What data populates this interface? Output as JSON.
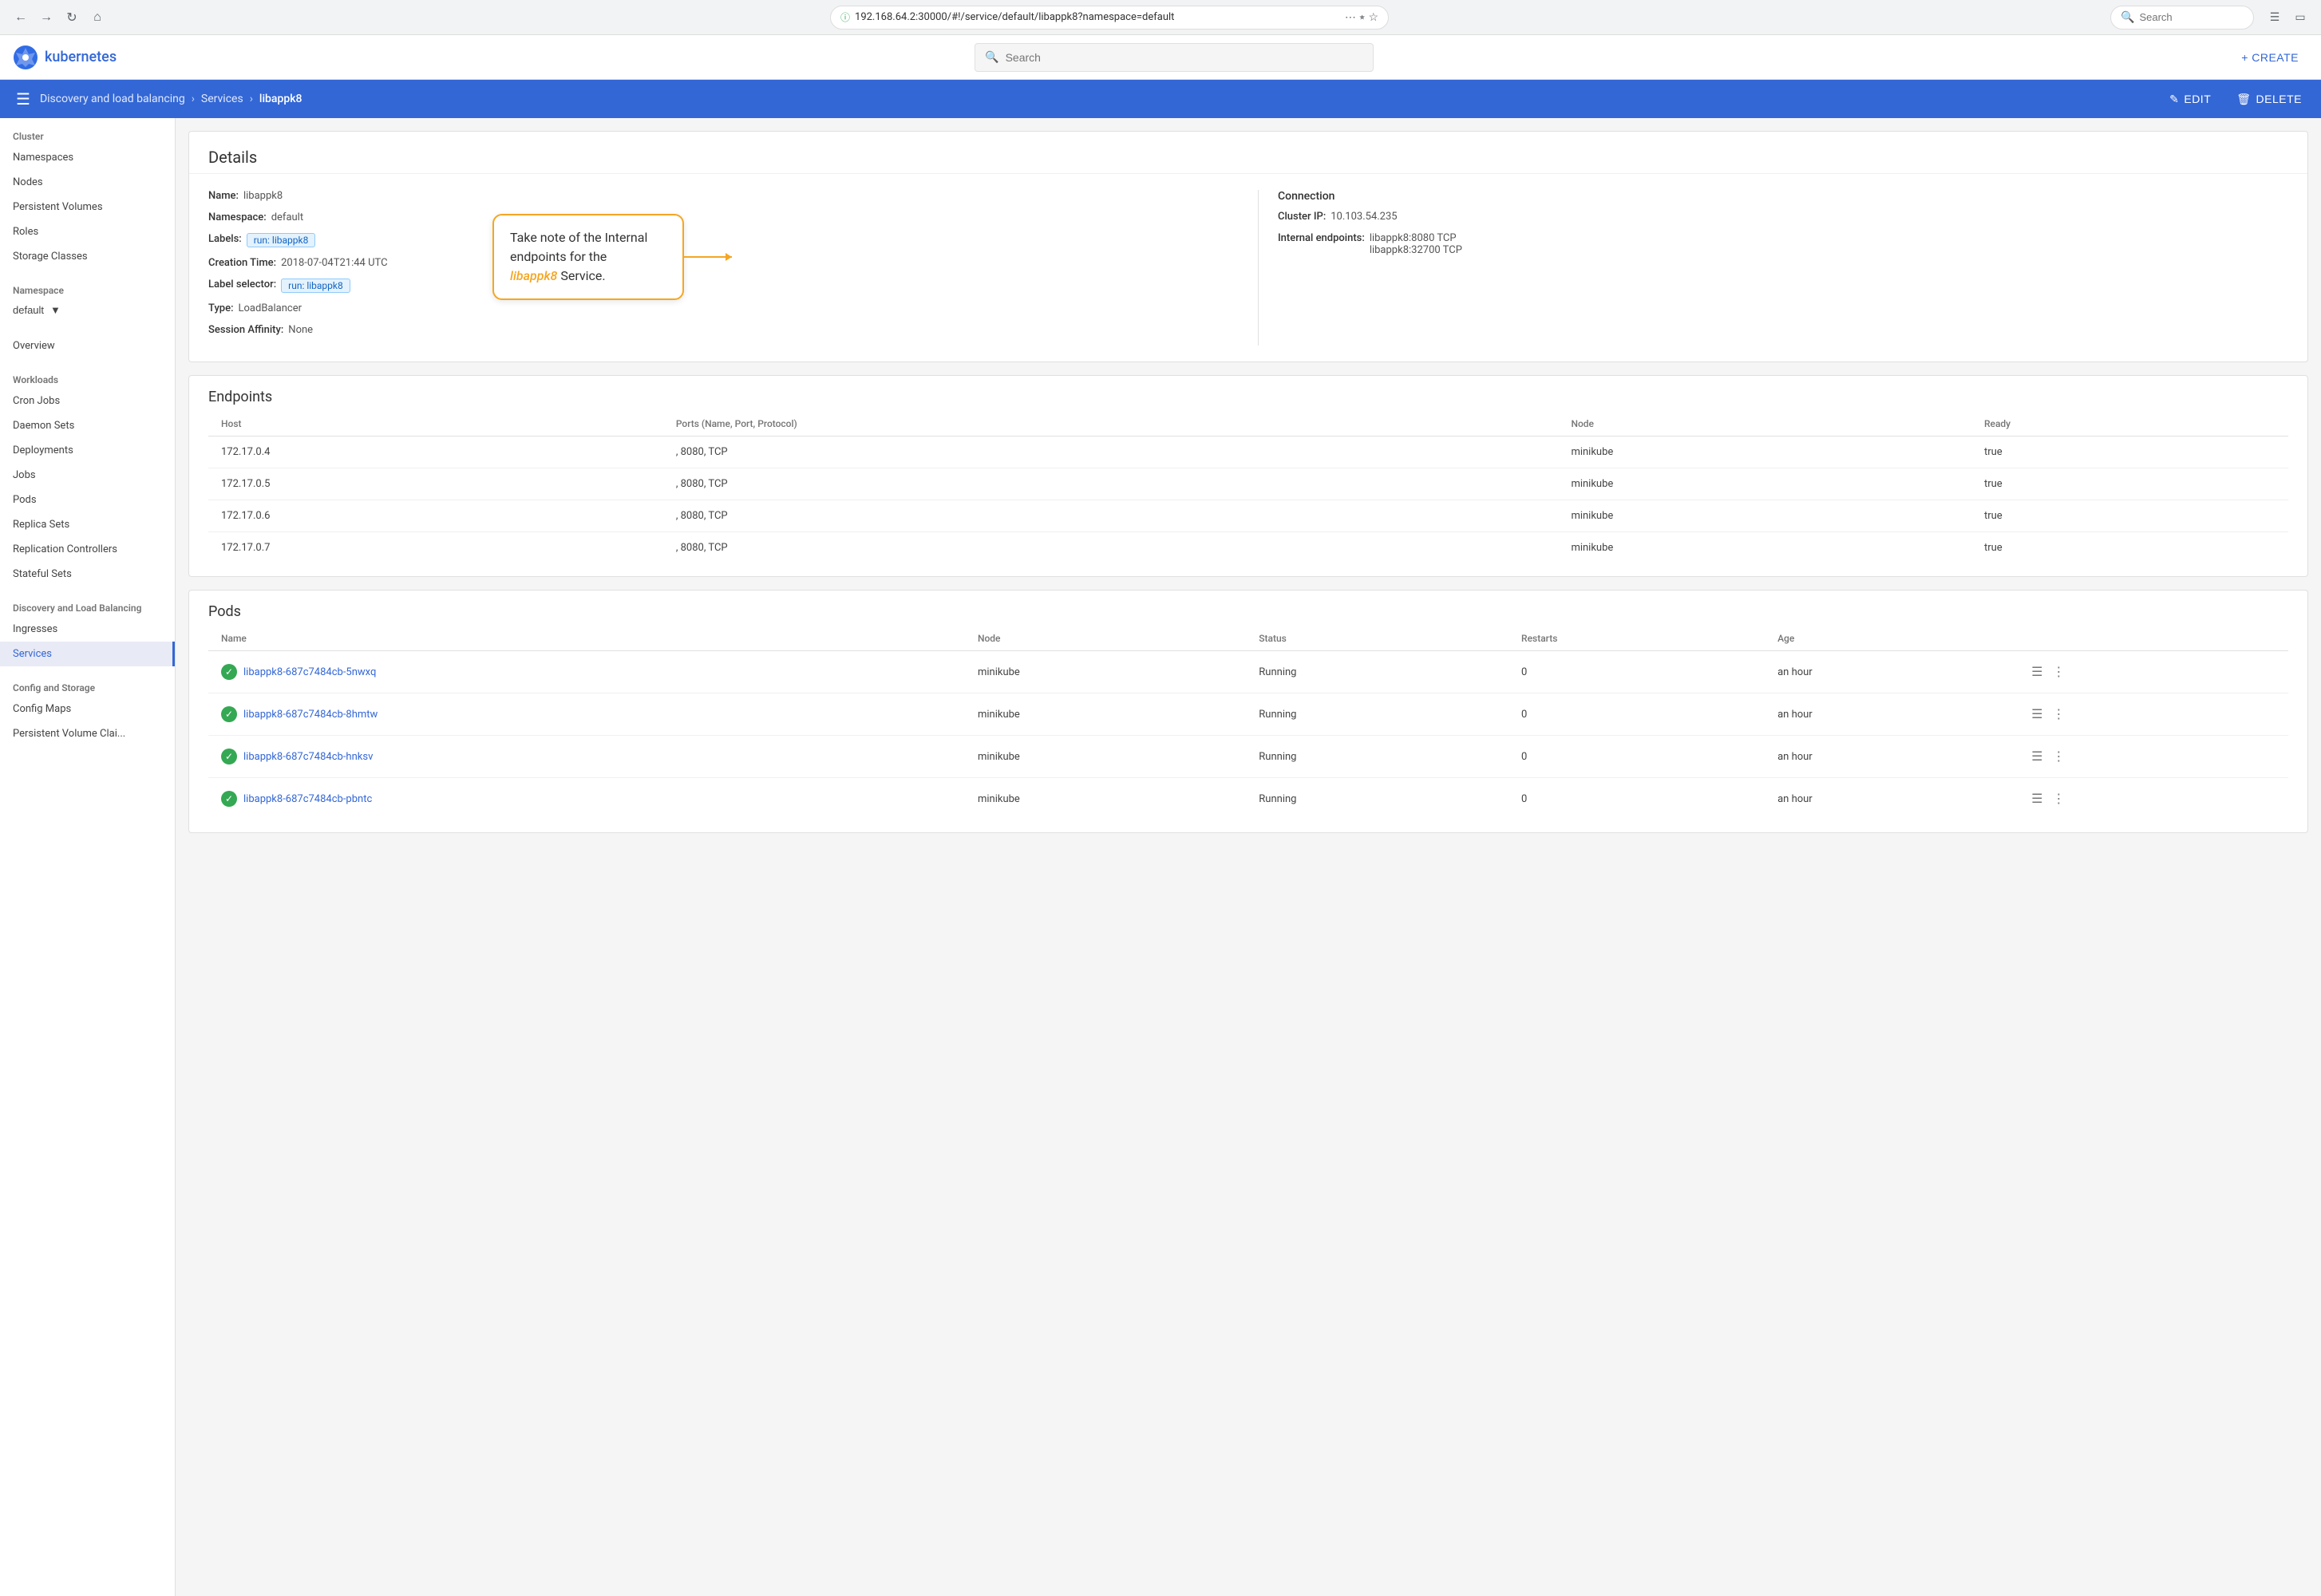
{
  "browser": {
    "url": "192.168.64.2:30000/#!/service/default/libappk8?namespace=default",
    "search_placeholder": "Search"
  },
  "app": {
    "name": "kubernetes",
    "search_placeholder": "Search",
    "create_label": "+ CREATE"
  },
  "breadcrumb": {
    "items": [
      {
        "label": "Discovery and load balancing",
        "active": false
      },
      {
        "label": "Services",
        "active": false
      },
      {
        "label": "libappk8",
        "active": true
      }
    ],
    "edit_label": "EDIT",
    "delete_label": "DELETE"
  },
  "sidebar": {
    "cluster_label": "Cluster",
    "cluster_items": [
      "Namespaces",
      "Nodes",
      "Persistent Volumes",
      "Roles",
      "Storage Classes"
    ],
    "namespace_label": "Namespace",
    "namespace_value": "default",
    "overview_label": "Overview",
    "workloads_label": "Workloads",
    "workloads_items": [
      "Cron Jobs",
      "Daemon Sets",
      "Deployments",
      "Jobs",
      "Pods",
      "Replica Sets",
      "Replication Controllers",
      "Stateful Sets"
    ],
    "discovery_label": "Discovery and Load Balancing",
    "discovery_items": [
      "Ingresses",
      "Services"
    ],
    "config_label": "Config and Storage",
    "config_items": [
      "Config Maps",
      "Persistent Volume Clai..."
    ]
  },
  "details": {
    "section_title": "Details",
    "name_label": "Name:",
    "name_value": "libappk8",
    "namespace_label": "Namespace:",
    "namespace_value": "default",
    "labels_label": "Labels:",
    "labels_value": "run: libappk8",
    "creation_label": "Creation Time:",
    "creation_value": "2018-07-04T21:44 UTC",
    "label_selector_label": "Label selector:",
    "label_selector_value": "run: libappk8",
    "type_label": "Type:",
    "type_value": "LoadBalancer",
    "session_affinity_label": "Session Affinity:",
    "session_affinity_value": "None",
    "connection_title": "Connection",
    "cluster_ip_label": "Cluster IP:",
    "cluster_ip_value": "10.103.54.235",
    "internal_endpoints_label": "Internal endpoints:",
    "internal_endpoints_values": [
      "libappk8:8080 TCP",
      "libappk8:32700 TCP"
    ],
    "annotation_text": "Take note of the Internal endpoints for the",
    "annotation_service": "libappk8",
    "annotation_suffix": "Service."
  },
  "endpoints": {
    "section_title": "Endpoints",
    "columns": [
      "Host",
      "Ports (Name, Port, Protocol)",
      "Node",
      "Ready"
    ],
    "rows": [
      {
        "host": "172.17.0.4",
        "ports": "<unset>, 8080, TCP",
        "node": "minikube",
        "ready": "true"
      },
      {
        "host": "172.17.0.5",
        "ports": "<unset>, 8080, TCP",
        "node": "minikube",
        "ready": "true"
      },
      {
        "host": "172.17.0.6",
        "ports": "<unset>, 8080, TCP",
        "node": "minikube",
        "ready": "true"
      },
      {
        "host": "172.17.0.7",
        "ports": "<unset>, 8080, TCP",
        "node": "minikube",
        "ready": "true"
      }
    ]
  },
  "pods": {
    "section_title": "Pods",
    "columns": [
      "Name",
      "Node",
      "Status",
      "Restarts",
      "Age"
    ],
    "rows": [
      {
        "name": "libappk8-687c7484cb-5nwxq",
        "node": "minikube",
        "status": "Running",
        "restarts": "0",
        "age": "an hour"
      },
      {
        "name": "libappk8-687c7484cb-8hmtw",
        "node": "minikube",
        "status": "Running",
        "restarts": "0",
        "age": "an hour"
      },
      {
        "name": "libappk8-687c7484cb-hnksv",
        "node": "minikube",
        "status": "Running",
        "restarts": "0",
        "age": "an hour"
      },
      {
        "name": "libappk8-687c7484cb-pbntc",
        "node": "minikube",
        "status": "Running",
        "restarts": "0",
        "age": "an hour"
      }
    ]
  },
  "colors": {
    "primary_blue": "#3367d6",
    "breadcrumb_bg": "#3367d6",
    "success_green": "#34a853",
    "annotation_yellow": "#f5a623"
  }
}
